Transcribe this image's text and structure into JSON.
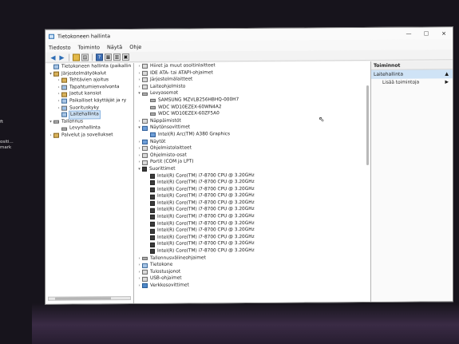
{
  "desktop": {
    "left_text": [
      "ft",
      "ositi...",
      "mark"
    ]
  },
  "window": {
    "title": "Tietokoneen hallinta",
    "controls": {
      "minimize": "—",
      "maximize": "☐",
      "close": "✕"
    }
  },
  "menu": [
    "Tiedosto",
    "Toiminto",
    "Näytä",
    "Ohje"
  ],
  "toolbar": [
    {
      "kind": "nav",
      "glyph": "◀",
      "name": "back-icon"
    },
    {
      "kind": "nav",
      "glyph": "▶",
      "name": "forward-icon"
    },
    {
      "kind": "yellow",
      "glyph": "",
      "name": "up-folder-icon"
    },
    {
      "kind": "box",
      "glyph": "▤",
      "name": "show-hide-tree-icon"
    },
    {
      "kind": "blue",
      "glyph": "?",
      "name": "help-icon"
    },
    {
      "kind": "box",
      "glyph": "▦",
      "name": "properties-icon"
    },
    {
      "kind": "box",
      "glyph": "▥",
      "name": "view-icon"
    },
    {
      "kind": "box",
      "glyph": "▣",
      "name": "monitor-icon"
    }
  ],
  "left_tree": [
    {
      "indent": 0,
      "exp": "",
      "icon": "comp",
      "label": "Tietokoneen hallinta (paikallin"
    },
    {
      "indent": 0,
      "exp": "▾",
      "icon": "tool",
      "label": "Järjestelmätyökalut"
    },
    {
      "indent": 1,
      "exp": "›",
      "icon": "tool",
      "label": "Tehtävien ajoitus"
    },
    {
      "indent": 1,
      "exp": "›",
      "icon": "sel",
      "label": "Tapahtumienvalvonta"
    },
    {
      "indent": 1,
      "exp": "›",
      "icon": "tool",
      "label": "Jaetut kansiot"
    },
    {
      "indent": 1,
      "exp": "›",
      "icon": "comp",
      "label": "Paikalliset käyttäjät ja ry"
    },
    {
      "indent": 1,
      "exp": "›",
      "icon": "sel",
      "label": "Suorituskyky"
    },
    {
      "indent": 1,
      "exp": "",
      "icon": "comp",
      "label": "Laitehallinta",
      "selected": true
    },
    {
      "indent": 0,
      "exp": "▾",
      "icon": "disk",
      "label": "Tallennus"
    },
    {
      "indent": 1,
      "exp": "",
      "icon": "disk",
      "label": "Levynhallinta"
    },
    {
      "indent": 0,
      "exp": "›",
      "icon": "tool",
      "label": "Palvelut ja sovellukset"
    }
  ],
  "device_tree": [
    {
      "indent": 0,
      "exp": "›",
      "icon": "",
      "label": "Hiiret ja muut osoitinlaitteet"
    },
    {
      "indent": 0,
      "exp": "›",
      "icon": "",
      "label": "IDE ATA- tai ATAPI-ohjaimet"
    },
    {
      "indent": 0,
      "exp": "›",
      "icon": "",
      "label": "Järjestelmälaitteet"
    },
    {
      "indent": 0,
      "exp": "›",
      "icon": "",
      "label": "Laiteohjelmisto"
    },
    {
      "indent": 0,
      "exp": "▾",
      "icon": "disk",
      "label": "Levyasemat"
    },
    {
      "indent": 1,
      "exp": "",
      "icon": "disk",
      "label": "SAMSUNG MZVLB256HBHQ-000H7"
    },
    {
      "indent": 1,
      "exp": "",
      "icon": "disk",
      "label": "WDC WD10EZEX-60WN4A2"
    },
    {
      "indent": 1,
      "exp": "",
      "icon": "disk",
      "label": "WDC WD10EZEX-60ZF5A0"
    },
    {
      "indent": 0,
      "exp": "›",
      "icon": "",
      "label": "Näppäimistöt"
    },
    {
      "indent": 0,
      "exp": "▾",
      "icon": "mon",
      "label": "Näytönsovittimet"
    },
    {
      "indent": 1,
      "exp": "",
      "icon": "mon",
      "label": "Intel(R) Arc(TM) A380 Graphics"
    },
    {
      "indent": 0,
      "exp": "›",
      "icon": "mon",
      "label": "Näytöt"
    },
    {
      "indent": 0,
      "exp": "›",
      "icon": "",
      "label": "Ohjelmistolaitteet"
    },
    {
      "indent": 0,
      "exp": "›",
      "icon": "",
      "label": "Ohjelmisto-osat"
    },
    {
      "indent": 0,
      "exp": "›",
      "icon": "",
      "label": "Portit (COM ja LPT)"
    },
    {
      "indent": 0,
      "exp": "▾",
      "icon": "cpu",
      "label": "Suorittimet"
    },
    {
      "indent": 1,
      "exp": "",
      "icon": "cpu",
      "label": "Intel(R) Core(TM) i7-8700 CPU @ 3.20GHz"
    },
    {
      "indent": 1,
      "exp": "",
      "icon": "cpu",
      "label": "Intel(R) Core(TM) i7-8700 CPU @ 3.20GHz"
    },
    {
      "indent": 1,
      "exp": "",
      "icon": "cpu",
      "label": "Intel(R) Core(TM) i7-8700 CPU @ 3.20GHz"
    },
    {
      "indent": 1,
      "exp": "",
      "icon": "cpu",
      "label": "Intel(R) Core(TM) i7-8700 CPU @ 3.20GHz"
    },
    {
      "indent": 1,
      "exp": "",
      "icon": "cpu",
      "label": "Intel(R) Core(TM) i7-8700 CPU @ 3.20GHz"
    },
    {
      "indent": 1,
      "exp": "",
      "icon": "cpu",
      "label": "Intel(R) Core(TM) i7-8700 CPU @ 3.20GHz"
    },
    {
      "indent": 1,
      "exp": "",
      "icon": "cpu",
      "label": "Intel(R) Core(TM) i7-8700 CPU @ 3.20GHz"
    },
    {
      "indent": 1,
      "exp": "",
      "icon": "cpu",
      "label": "Intel(R) Core(TM) i7-8700 CPU @ 3.20GHz"
    },
    {
      "indent": 1,
      "exp": "",
      "icon": "cpu",
      "label": "Intel(R) Core(TM) i7-8700 CPU @ 3.20GHz"
    },
    {
      "indent": 1,
      "exp": "",
      "icon": "cpu",
      "label": "Intel(R) Core(TM) i7-8700 CPU @ 3.20GHz"
    },
    {
      "indent": 1,
      "exp": "",
      "icon": "cpu",
      "label": "Intel(R) Core(TM) i7-8700 CPU @ 3.20GHz"
    },
    {
      "indent": 1,
      "exp": "",
      "icon": "cpu",
      "label": "Intel(R) Core(TM) i7-8700 CPU @ 3.20GHz"
    },
    {
      "indent": 0,
      "exp": "›",
      "icon": "disk",
      "label": "Tallennusvälineohjaimet"
    },
    {
      "indent": 0,
      "exp": "›",
      "icon": "comp",
      "label": "Tietokone"
    },
    {
      "indent": 0,
      "exp": "›",
      "icon": "",
      "label": "Tulostusjonot"
    },
    {
      "indent": 0,
      "exp": "›",
      "icon": "",
      "label": "USB-ohjaimet"
    },
    {
      "indent": 0,
      "exp": "›",
      "icon": "net",
      "label": "Verkkosovittimet"
    }
  ],
  "actions": {
    "header": "Toiminnot",
    "section": "Laitehallinta",
    "section_arrow": "▲",
    "items": [
      {
        "label": "Lisää toimintoja",
        "arrow": "▶"
      }
    ]
  }
}
